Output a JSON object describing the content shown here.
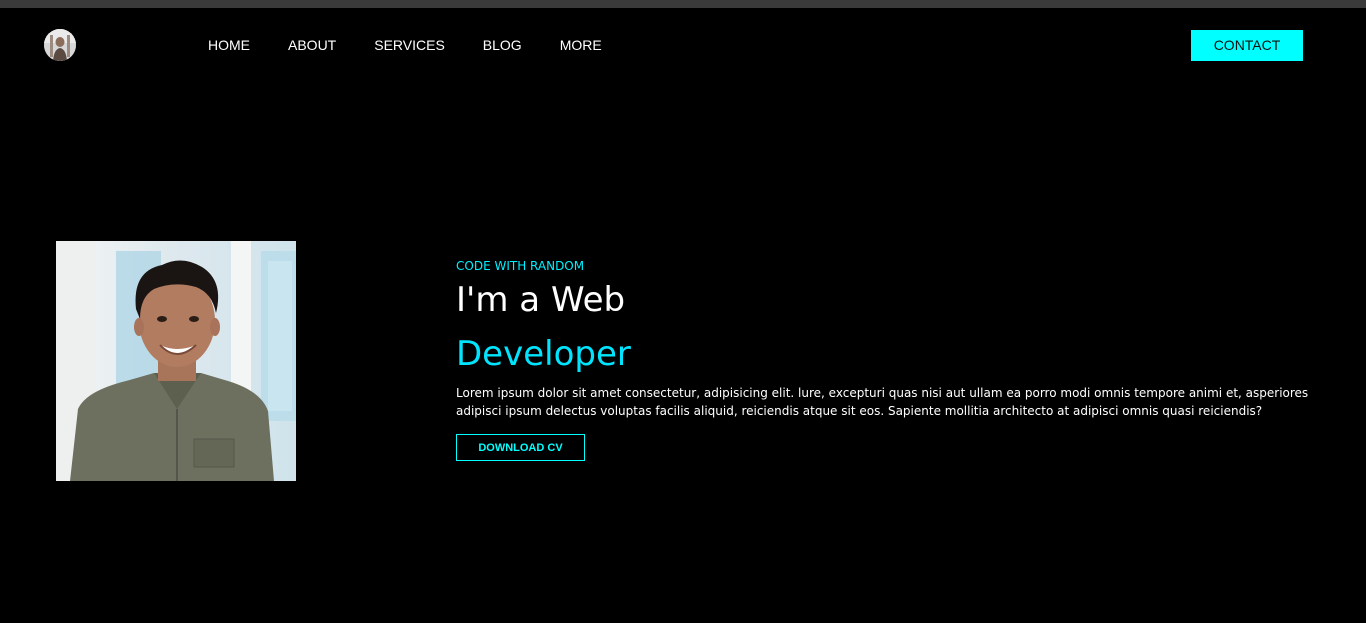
{
  "nav": {
    "items": [
      {
        "label": "HOME"
      },
      {
        "label": "ABOUT"
      },
      {
        "label": "SERVICES"
      },
      {
        "label": "BLOG"
      },
      {
        "label": "MORE"
      }
    ],
    "contact_label": "CONTACT"
  },
  "hero": {
    "kicker": "CODE WITH RANDOM",
    "title_line1": "I'm a Web",
    "title_line2": "Developer",
    "description": "Lorem ipsum dolor sit amet consectetur, adipisicing elit. lure, excepturi quas nisi aut ullam ea porro modi omnis tempore animi et, asperiores adipisci ipsum delectus voluptas facilis aliquid, reiciendis atque sit eos. Sapiente mollitia architecto at adipisci omnis quasi reiciendis?",
    "download_label": "DOWNLOAD CV"
  },
  "colors": {
    "background": "#000000",
    "accent": "#00ffff",
    "text": "#ffffff"
  }
}
